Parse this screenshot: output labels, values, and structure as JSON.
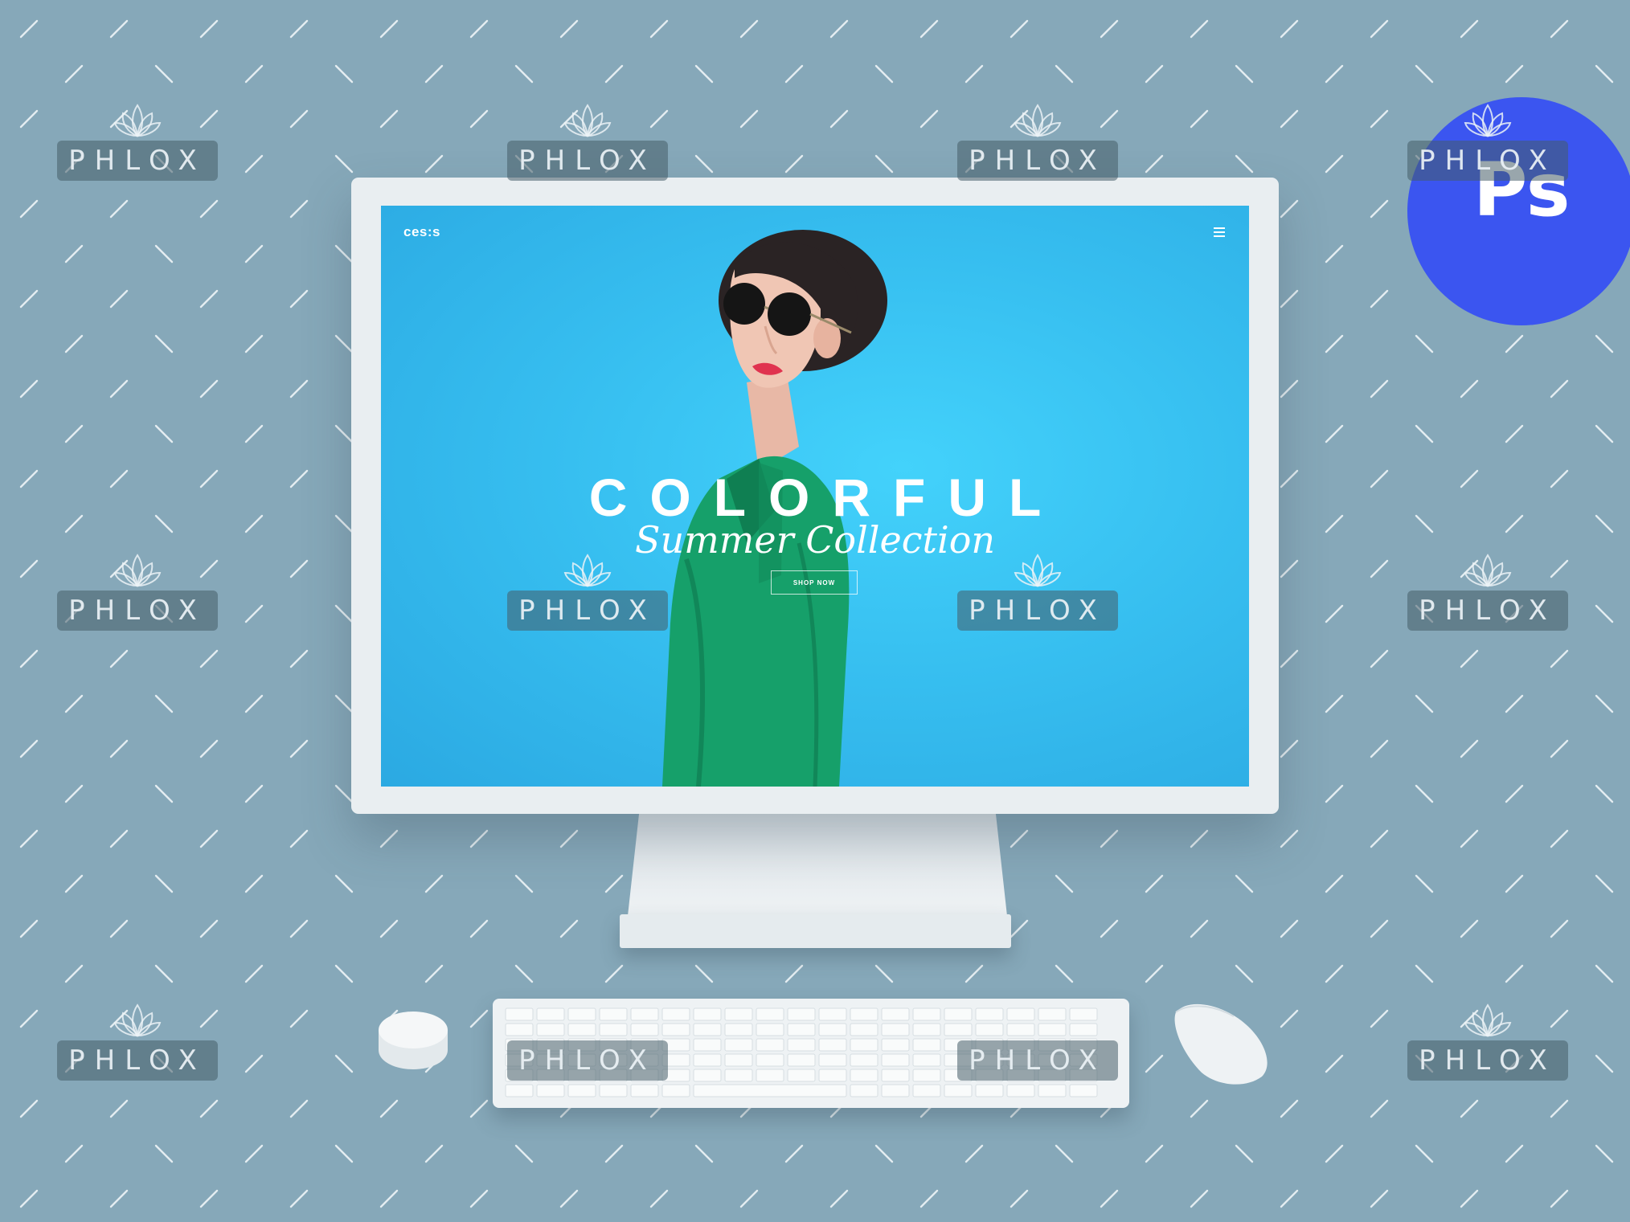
{
  "brand_watermark": "PHLOX",
  "badge": {
    "label": "Ps",
    "color": "#3b55f0"
  },
  "website": {
    "logo": "ces:s",
    "headline": "COLORFUL",
    "subheadline": "Summer Collection",
    "cta": "SHOP NOW",
    "menu_icon": "hamburger-icon",
    "background_color": "#3cc6f4",
    "shirt_color": "#16a06a"
  },
  "colors": {
    "background": "#86a8b9",
    "device": "#e9eef1"
  }
}
